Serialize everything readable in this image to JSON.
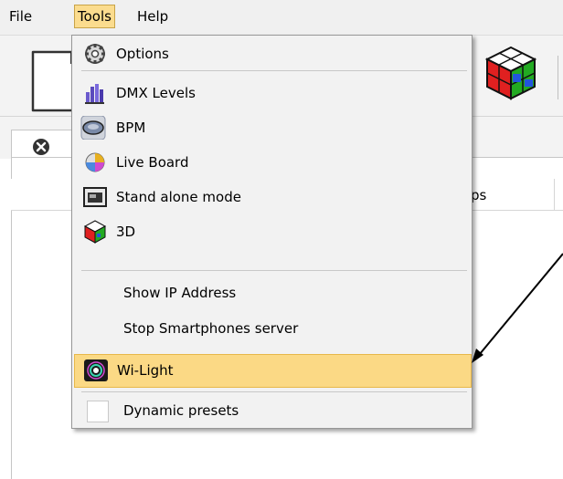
{
  "menubar": {
    "items": [
      {
        "label": "File"
      },
      {
        "label": "Tools"
      },
      {
        "label": "Help"
      }
    ]
  },
  "tools_menu": {
    "items": [
      {
        "label": "Options",
        "icon": "gear-icon"
      },
      {
        "label": "DMX Levels",
        "icon": "dmx-levels-icon"
      },
      {
        "label": "BPM",
        "icon": "bpm-disc-icon"
      },
      {
        "label": "Live Board",
        "icon": "live-board-icon"
      },
      {
        "label": "Stand alone mode",
        "icon": "stand-alone-icon"
      },
      {
        "label": "3D",
        "icon": "cube-3d-icon"
      },
      {
        "label": "Show IP Address"
      },
      {
        "label": "Stop Smartphones server"
      },
      {
        "label": "Wi-Light",
        "icon": "wi-light-icon",
        "highlighted": true
      },
      {
        "label": "Dynamic presets",
        "checked": false
      }
    ]
  },
  "content": {
    "column_header_fragment": "ps"
  },
  "colors": {
    "menu_highlight": "#fbd985",
    "arrow": "#000000"
  }
}
